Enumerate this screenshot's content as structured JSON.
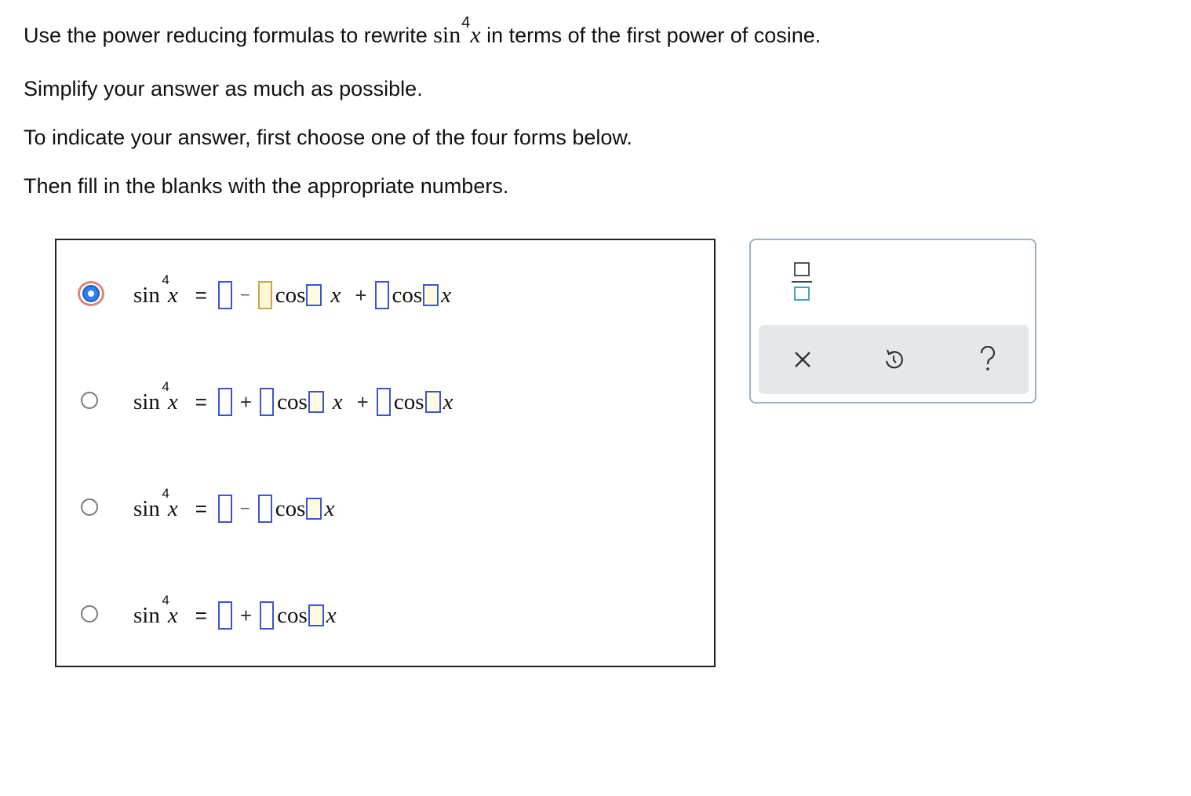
{
  "instructions": {
    "line1_before": "Use the power reducing formulas to rewrite",
    "line1_sin": "sin",
    "line1_power": "4",
    "line1_var": "x",
    "line1_after": "in terms of the first power of cosine.",
    "line2": "Simplify your answer as much as possible.",
    "line3": "To indicate your answer, first choose one of the four forms below.",
    "line4": "Then fill in the blanks with the appropriate numbers."
  },
  "formula": {
    "sin": "sin",
    "power": "4",
    "var": "x",
    "equals": "=",
    "cos": "cos",
    "plus": "+",
    "minus": "−"
  },
  "options": [
    {
      "form": "sin^4 x = [] - [] cos [] x + [] cos [] x",
      "selected": true
    },
    {
      "form": "sin^4 x = [] + [] cos [] x + [] cos [] x",
      "selected": false
    },
    {
      "form": "sin^4 x = [] - [] cos [] x",
      "selected": false
    },
    {
      "form": "sin^4 x = [] + [] cos [] x",
      "selected": false
    }
  ],
  "tools": {
    "fraction_icon": "fraction-template-icon",
    "clear_icon": "x-icon",
    "undo_icon": "undo-icon",
    "help_icon": "question-mark-icon"
  },
  "colors": {
    "selected_radio": "#2f80ed",
    "selected_ring": "#e0837a",
    "blank_border": "#3b55d6",
    "tool_bar": "#e4e8eb"
  }
}
